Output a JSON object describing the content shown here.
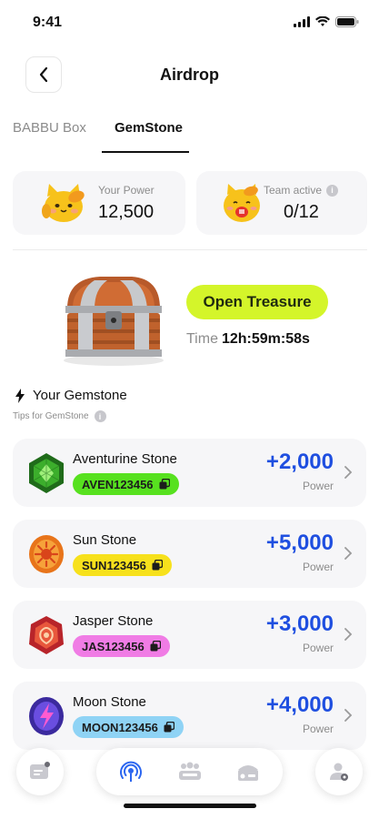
{
  "status_bar": {
    "time": "9:41"
  },
  "header": {
    "title": "Airdrop"
  },
  "tabs": [
    {
      "label": "BABBU Box",
      "active": false
    },
    {
      "label": "GemStone",
      "active": true
    }
  ],
  "stats": {
    "power": {
      "label": "Your Power",
      "value": "12,500"
    },
    "team": {
      "label": "Team active",
      "value": "0/12"
    }
  },
  "treasure": {
    "button_label": "Open Treasure",
    "time_label": "Time",
    "time_value": "12h:59m:58s"
  },
  "section": {
    "title": "Your Gemstone",
    "tip": "Tips for GemStone"
  },
  "gems": [
    {
      "name": "Aventurine Stone",
      "code": "AVEN123456",
      "code_color": "#57e11f",
      "power": "+2,000",
      "power_label": "Power",
      "icon": "green-gem-icon"
    },
    {
      "name": "Sun Stone",
      "code": "SUN123456",
      "code_color": "#f7e11c",
      "power": "+5,000",
      "power_label": "Power",
      "icon": "orange-gem-icon"
    },
    {
      "name": "Jasper Stone",
      "code": "JAS123456",
      "code_color": "#f07ce5",
      "power": "+3,000",
      "power_label": "Power",
      "icon": "red-gem-icon"
    },
    {
      "name": "Moon Stone",
      "code": "MOON123456",
      "code_color": "#8fd3f5",
      "power": "+4,000",
      "power_label": "Power",
      "icon": "purple-gem-icon"
    }
  ],
  "colors": {
    "accent_lime": "#d4f52a",
    "power_blue": "#1f4fe0",
    "nav_active": "#2b66f0"
  },
  "nav": [
    "chat-icon",
    "airdrop-icon",
    "team-icon",
    "vault-icon",
    "profile-icon"
  ]
}
